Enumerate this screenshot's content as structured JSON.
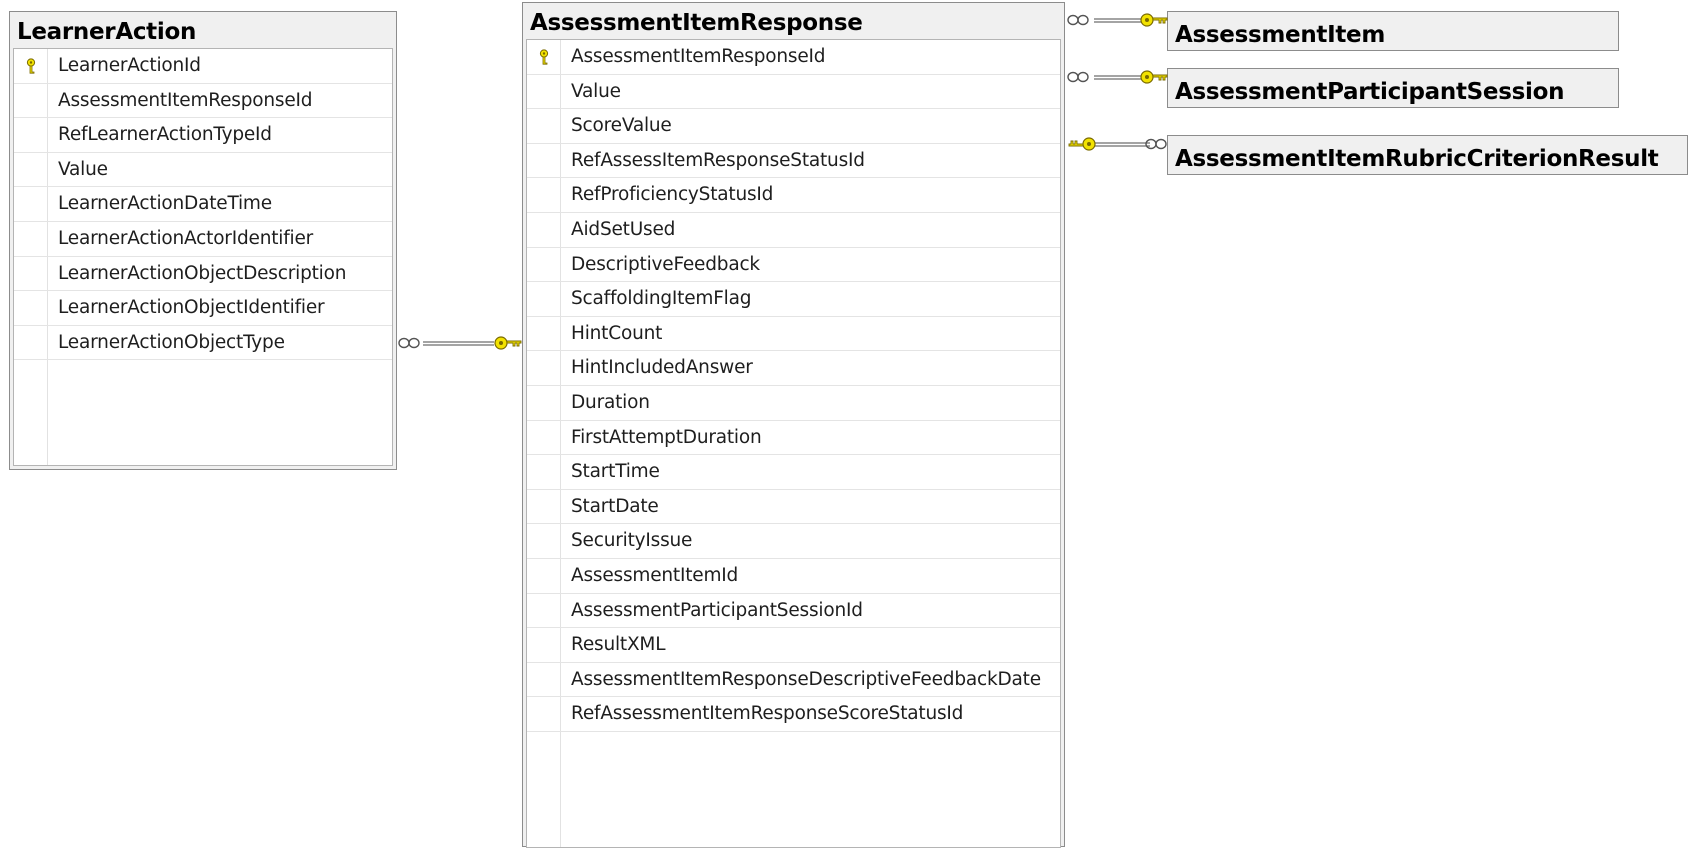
{
  "tables": {
    "learner_action": {
      "title": "LearnerAction",
      "columns": [
        "LearnerActionId",
        "AssessmentItemResponseId",
        "RefLearnerActionTypeId",
        "Value",
        "LearnerActionDateTime",
        "LearnerActionActorIdentifier",
        "LearnerActionObjectDescription",
        "LearnerActionObjectIdentifier",
        "LearnerActionObjectType"
      ]
    },
    "assessment_item_response": {
      "title": "AssessmentItemResponse",
      "columns": [
        "AssessmentItemResponseId",
        "Value",
        "ScoreValue",
        "RefAssessItemResponseStatusId",
        "RefProficiencyStatusId",
        "AidSetUsed",
        "DescriptiveFeedback",
        "ScaffoldingItemFlag",
        "HintCount",
        "HintIncludedAnswer",
        "Duration",
        "FirstAttemptDuration",
        "StartTime",
        "StartDate",
        "SecurityIssue",
        "AssessmentItemId",
        "AssessmentParticipantSessionId",
        "ResultXML",
        "AssessmentItemResponseDescriptiveFeedbackDate",
        "RefAssessmentItemResponseScoreStatusId"
      ]
    },
    "assessment_item": {
      "title": "AssessmentItem"
    },
    "assessment_participant_session": {
      "title": "AssessmentParticipantSession"
    },
    "assessment_item_rubric_criterion_result": {
      "title": "AssessmentItemRubricCriterionResult"
    }
  },
  "icons": {
    "primary_key": "key-icon",
    "relationship_many": "infinity-icon",
    "relationship_one": "key-icon"
  },
  "colors": {
    "key": "#f2e200",
    "key_outline": "#7a6a00",
    "relationship_line": "#6e6e6e"
  }
}
